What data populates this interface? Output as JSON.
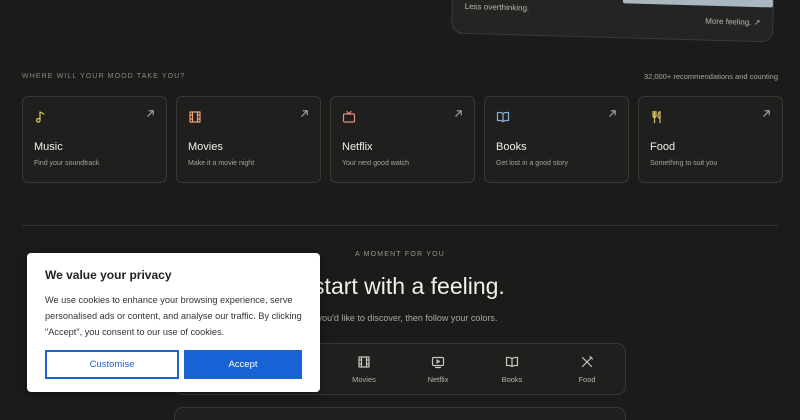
{
  "hero": {
    "left_text": "Less overthinking.",
    "right_text": "More feeling. ↗"
  },
  "section": {
    "label": "WHERE WILL YOUR MOOD TAKE YOU?",
    "count": "32,000+ recommendations and counting"
  },
  "categories": [
    {
      "title": "Music",
      "subtitle": "Find your soundtrack",
      "icon": "music-note-icon",
      "color": "#e0c15a"
    },
    {
      "title": "Movies",
      "subtitle": "Make it a movie night",
      "icon": "film-icon",
      "color": "#e89f75"
    },
    {
      "title": "Netflix",
      "subtitle": "Your next good watch",
      "icon": "tv-icon",
      "color": "#e38b80"
    },
    {
      "title": "Books",
      "subtitle": "Get lost in a good story",
      "icon": "book-icon",
      "color": "#8fb1d8"
    },
    {
      "title": "Food",
      "subtitle": "Something to suit you",
      "icon": "fork-knife-icon",
      "color": "#d8c36a"
    }
  ],
  "moment": {
    "label": "A MOMENT FOR YOU",
    "headline": "s start with a feeling.",
    "subline": "hat you'd like to discover, then follow your colors."
  },
  "selector": {
    "items": [
      "Movies",
      "Netflix",
      "Books",
      "Food"
    ]
  },
  "cookie": {
    "title": "We value your privacy",
    "body": "We use cookies to enhance your browsing experience, serve personalised ads or content, and analyse our traffic. By clicking \"Accept\", you consent to our use of cookies.",
    "customise_label": "Customise",
    "accept_label": "Accept"
  },
  "colors": {
    "background": "#1b1b19",
    "accent_blue": "#1763d6",
    "card_border": "#383935"
  }
}
